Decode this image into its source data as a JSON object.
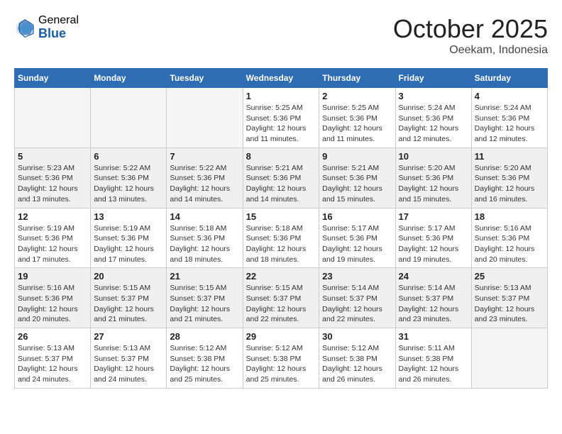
{
  "header": {
    "logo_general": "General",
    "logo_blue": "Blue",
    "month_title": "October 2025",
    "location": "Oeekam, Indonesia"
  },
  "weekdays": [
    "Sunday",
    "Monday",
    "Tuesday",
    "Wednesday",
    "Thursday",
    "Friday",
    "Saturday"
  ],
  "weeks": [
    [
      {
        "num": "",
        "info": ""
      },
      {
        "num": "",
        "info": ""
      },
      {
        "num": "",
        "info": ""
      },
      {
        "num": "1",
        "info": "Sunrise: 5:25 AM\nSunset: 5:36 PM\nDaylight: 12 hours\nand 11 minutes."
      },
      {
        "num": "2",
        "info": "Sunrise: 5:25 AM\nSunset: 5:36 PM\nDaylight: 12 hours\nand 11 minutes."
      },
      {
        "num": "3",
        "info": "Sunrise: 5:24 AM\nSunset: 5:36 PM\nDaylight: 12 hours\nand 12 minutes."
      },
      {
        "num": "4",
        "info": "Sunrise: 5:24 AM\nSunset: 5:36 PM\nDaylight: 12 hours\nand 12 minutes."
      }
    ],
    [
      {
        "num": "5",
        "info": "Sunrise: 5:23 AM\nSunset: 5:36 PM\nDaylight: 12 hours\nand 13 minutes."
      },
      {
        "num": "6",
        "info": "Sunrise: 5:22 AM\nSunset: 5:36 PM\nDaylight: 12 hours\nand 13 minutes."
      },
      {
        "num": "7",
        "info": "Sunrise: 5:22 AM\nSunset: 5:36 PM\nDaylight: 12 hours\nand 14 minutes."
      },
      {
        "num": "8",
        "info": "Sunrise: 5:21 AM\nSunset: 5:36 PM\nDaylight: 12 hours\nand 14 minutes."
      },
      {
        "num": "9",
        "info": "Sunrise: 5:21 AM\nSunset: 5:36 PM\nDaylight: 12 hours\nand 15 minutes."
      },
      {
        "num": "10",
        "info": "Sunrise: 5:20 AM\nSunset: 5:36 PM\nDaylight: 12 hours\nand 15 minutes."
      },
      {
        "num": "11",
        "info": "Sunrise: 5:20 AM\nSunset: 5:36 PM\nDaylight: 12 hours\nand 16 minutes."
      }
    ],
    [
      {
        "num": "12",
        "info": "Sunrise: 5:19 AM\nSunset: 5:36 PM\nDaylight: 12 hours\nand 17 minutes."
      },
      {
        "num": "13",
        "info": "Sunrise: 5:19 AM\nSunset: 5:36 PM\nDaylight: 12 hours\nand 17 minutes."
      },
      {
        "num": "14",
        "info": "Sunrise: 5:18 AM\nSunset: 5:36 PM\nDaylight: 12 hours\nand 18 minutes."
      },
      {
        "num": "15",
        "info": "Sunrise: 5:18 AM\nSunset: 5:36 PM\nDaylight: 12 hours\nand 18 minutes."
      },
      {
        "num": "16",
        "info": "Sunrise: 5:17 AM\nSunset: 5:36 PM\nDaylight: 12 hours\nand 19 minutes."
      },
      {
        "num": "17",
        "info": "Sunrise: 5:17 AM\nSunset: 5:36 PM\nDaylight: 12 hours\nand 19 minutes."
      },
      {
        "num": "18",
        "info": "Sunrise: 5:16 AM\nSunset: 5:36 PM\nDaylight: 12 hours\nand 20 minutes."
      }
    ],
    [
      {
        "num": "19",
        "info": "Sunrise: 5:16 AM\nSunset: 5:36 PM\nDaylight: 12 hours\nand 20 minutes."
      },
      {
        "num": "20",
        "info": "Sunrise: 5:15 AM\nSunset: 5:37 PM\nDaylight: 12 hours\nand 21 minutes."
      },
      {
        "num": "21",
        "info": "Sunrise: 5:15 AM\nSunset: 5:37 PM\nDaylight: 12 hours\nand 21 minutes."
      },
      {
        "num": "22",
        "info": "Sunrise: 5:15 AM\nSunset: 5:37 PM\nDaylight: 12 hours\nand 22 minutes."
      },
      {
        "num": "23",
        "info": "Sunrise: 5:14 AM\nSunset: 5:37 PM\nDaylight: 12 hours\nand 22 minutes."
      },
      {
        "num": "24",
        "info": "Sunrise: 5:14 AM\nSunset: 5:37 PM\nDaylight: 12 hours\nand 23 minutes."
      },
      {
        "num": "25",
        "info": "Sunrise: 5:13 AM\nSunset: 5:37 PM\nDaylight: 12 hours\nand 23 minutes."
      }
    ],
    [
      {
        "num": "26",
        "info": "Sunrise: 5:13 AM\nSunset: 5:37 PM\nDaylight: 12 hours\nand 24 minutes."
      },
      {
        "num": "27",
        "info": "Sunrise: 5:13 AM\nSunset: 5:37 PM\nDaylight: 12 hours\nand 24 minutes."
      },
      {
        "num": "28",
        "info": "Sunrise: 5:12 AM\nSunset: 5:38 PM\nDaylight: 12 hours\nand 25 minutes."
      },
      {
        "num": "29",
        "info": "Sunrise: 5:12 AM\nSunset: 5:38 PM\nDaylight: 12 hours\nand 25 minutes."
      },
      {
        "num": "30",
        "info": "Sunrise: 5:12 AM\nSunset: 5:38 PM\nDaylight: 12 hours\nand 26 minutes."
      },
      {
        "num": "31",
        "info": "Sunrise: 5:11 AM\nSunset: 5:38 PM\nDaylight: 12 hours\nand 26 minutes."
      },
      {
        "num": "",
        "info": ""
      }
    ]
  ]
}
